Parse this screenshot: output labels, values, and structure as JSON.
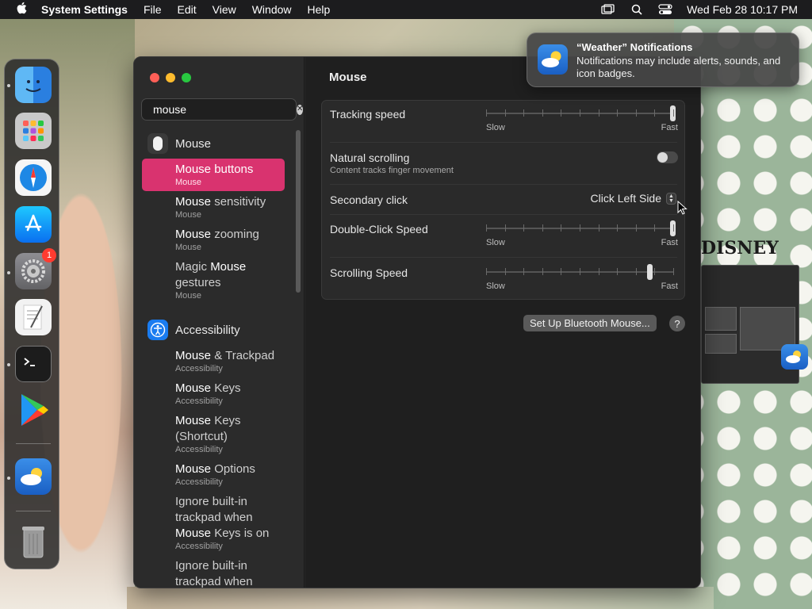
{
  "menubar": {
    "app_name": "System Settings",
    "menus": [
      "File",
      "Edit",
      "View",
      "Window",
      "Help"
    ],
    "clock": "Wed Feb 28  10:17 PM"
  },
  "dock": {
    "apps": [
      "Finder",
      "Launchpad",
      "Safari",
      "App Store",
      "System Settings",
      "TextEdit",
      "Terminal",
      "Google Play",
      "Weather",
      "Trash"
    ],
    "system_settings_badge": "1"
  },
  "sidebar": {
    "search_value": "mouse",
    "groups": [
      {
        "title": "Mouse",
        "items": [
          {
            "pre": "",
            "bold": "Mouse",
            "post": " buttons",
            "sub": "Mouse"
          },
          {
            "pre": "",
            "bold": "Mouse",
            "post": " sensitivity",
            "sub": "Mouse"
          },
          {
            "pre": "",
            "bold": "Mouse",
            "post": " zooming",
            "sub": "Mouse"
          },
          {
            "pre": "Magic ",
            "bold": "Mouse",
            "post": " gestures",
            "sub": "Mouse"
          }
        ]
      },
      {
        "title": "Accessibility",
        "items": [
          {
            "pre": "",
            "bold": "Mouse",
            "post": " & Trackpad",
            "sub": "Accessibility"
          },
          {
            "pre": "",
            "bold": "Mouse",
            "post": " Keys",
            "sub": "Accessibility"
          },
          {
            "pre": "",
            "bold": "Mouse",
            "post": " Keys (Shortcut)",
            "sub": "Accessibility"
          },
          {
            "pre": "",
            "bold": "Mouse",
            "post": " Options",
            "sub": "Accessibility"
          },
          {
            "pre": "Ignore built-in trackpad when ",
            "bold": "Mouse",
            "post": " Keys is on",
            "sub": "Accessibility"
          },
          {
            "pre": "Ignore built-in trackpad when",
            "bold": "",
            "post": "",
            "sub": ""
          }
        ]
      }
    ]
  },
  "main": {
    "title": "Mouse",
    "tracking_speed": {
      "label": "Tracking speed",
      "slow": "Slow",
      "fast": "Fast",
      "value": 1.0
    },
    "natural_scrolling": {
      "label": "Natural scrolling",
      "sub": "Content tracks finger movement",
      "on": false
    },
    "secondary_click": {
      "label": "Secondary click",
      "value": "Click Left Side"
    },
    "double_click_speed": {
      "label": "Double-Click Speed",
      "slow": "Slow",
      "fast": "Fast",
      "value": 1.0
    },
    "scrolling_speed": {
      "label": "Scrolling Speed",
      "slow": "Slow",
      "fast": "Fast",
      "value": 0.875
    },
    "bluetooth_button": "Set Up Bluetooth Mouse...",
    "help_button": "?"
  },
  "notification": {
    "title": "“Weather” Notifications",
    "body": "Notifications may include alerts, sounds, and icon badges."
  },
  "wallpaper": {
    "sign": "DISNEY"
  },
  "colors": {
    "accent": "#d9336f",
    "close": "#ff5f57",
    "minimize": "#febc2e",
    "zoom": "#28c840"
  }
}
